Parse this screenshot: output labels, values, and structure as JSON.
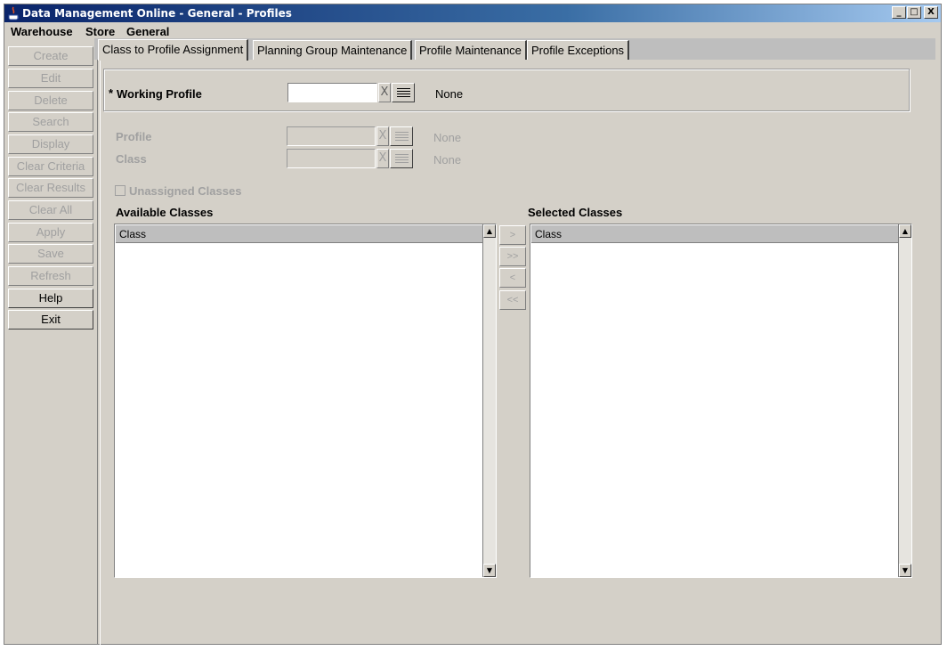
{
  "window": {
    "title": "Data Management Online - General - Profiles",
    "controls": [
      "_",
      "□",
      "X"
    ]
  },
  "menubar": [
    "Warehouse",
    "Store",
    "General"
  ],
  "sidebar": {
    "buttons": [
      {
        "label": "Create",
        "enabled": false
      },
      {
        "label": "Edit",
        "enabled": false
      },
      {
        "label": "Delete",
        "enabled": false
      },
      {
        "label": "Search",
        "enabled": false
      },
      {
        "label": "Display",
        "enabled": false
      },
      {
        "label": "Clear Criteria",
        "enabled": false
      },
      {
        "label": "Clear Results",
        "enabled": false
      },
      {
        "label": "Clear All",
        "enabled": false
      },
      {
        "label": "Apply",
        "enabled": false
      },
      {
        "label": "Save",
        "enabled": false
      },
      {
        "label": "Refresh",
        "enabled": false
      },
      {
        "label": "Help",
        "enabled": true
      },
      {
        "label": "Exit",
        "enabled": true
      }
    ]
  },
  "tabs": [
    "Class to Profile Assignment",
    "Planning Group Maintenance",
    "Profile Maintenance",
    "Profile Exceptions"
  ],
  "active_tab": "Class to Profile Assignment",
  "working_profile": {
    "required_mark": "*",
    "label": "Working Profile",
    "value": "",
    "clear": "X",
    "description": "None"
  },
  "profile": {
    "label": "Profile",
    "value": "",
    "clear": "X",
    "description": "None"
  },
  "class_field": {
    "label": "Class",
    "value": "",
    "clear": "X",
    "description": "None"
  },
  "unassigned": {
    "label": "Unassigned Classes",
    "checked": false
  },
  "available": {
    "title": "Available Classes",
    "column": "Class"
  },
  "selected": {
    "title": "Selected Classes",
    "column": "Class"
  },
  "move_buttons": [
    ">",
    ">>",
    "<",
    "<<"
  ],
  "scroll": {
    "up": "▲",
    "down": "▼"
  }
}
